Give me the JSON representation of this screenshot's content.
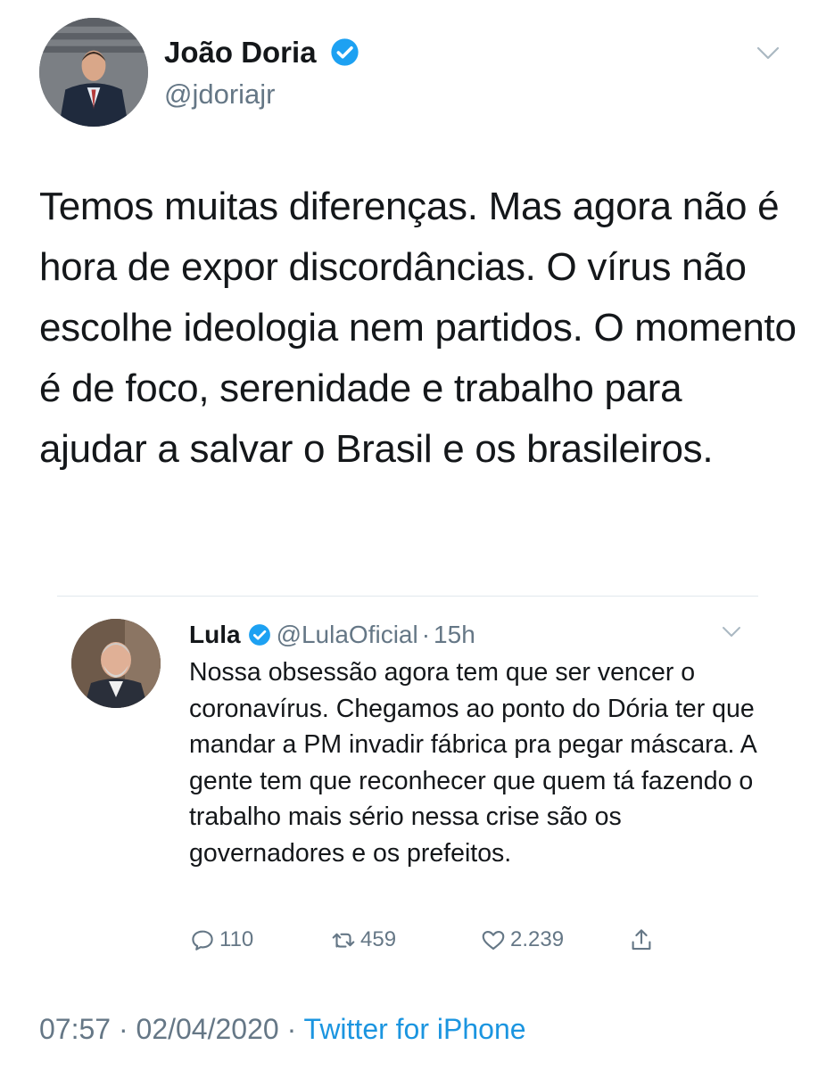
{
  "tweet": {
    "author_name": "João Doria",
    "author_handle": "@jdoriajr",
    "verified_icon": "verified-badge-icon",
    "text": "Temos muitas diferenças. Mas agora não é hora de expor discordâncias. O vírus não escolhe ideologia nem partidos. O momento é de foco, serenidade e trabalho para ajudar a salvar o Brasil e os brasileiros.",
    "time": "07:57",
    "separator": "·",
    "date": "02/04/2020",
    "source": "Twitter for iPhone"
  },
  "quoted": {
    "author_name": "Lula",
    "author_handle": "@LulaOficial",
    "separator": "·",
    "time_ago": "15h",
    "text": "Nossa obsessão agora tem que ser vencer o coronavírus. Chegamos ao ponto do Dória ter que mandar a PM invadir fábrica pra pegar máscara. A gente tem que reconhecer que quem tá fazendo o trabalho mais sério nessa crise são os governadores e os prefeitos.",
    "replies": "110",
    "retweets": "459",
    "likes": "2.239"
  },
  "colors": {
    "text": "#14171a",
    "secondary": "#657786",
    "link": "#1b95e0",
    "verified": "#1da1f2",
    "divider": "#e1e8ed"
  }
}
